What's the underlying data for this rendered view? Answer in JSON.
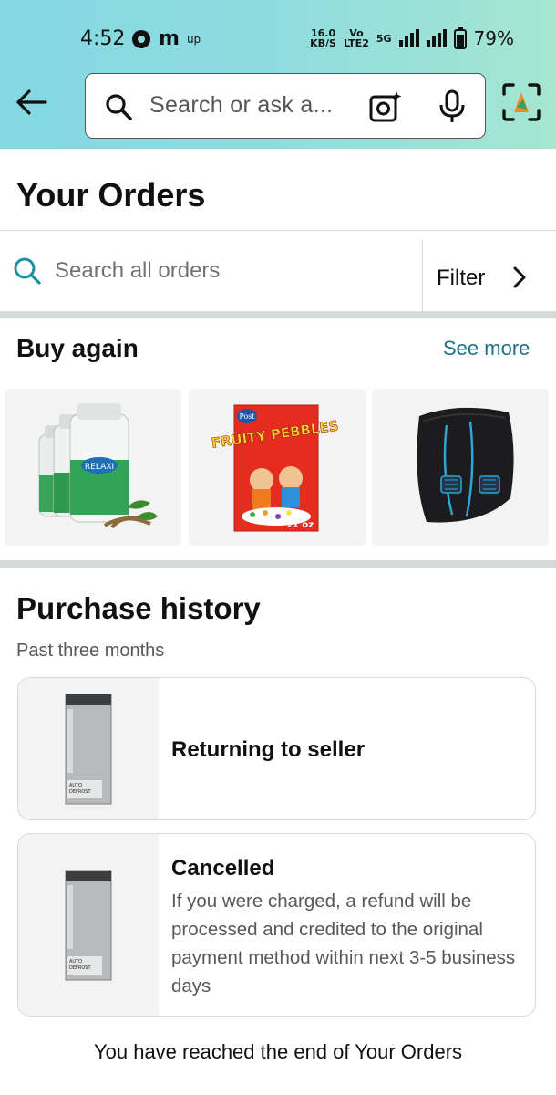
{
  "status_bar": {
    "time": "4:52",
    "app_icons": [
      "m",
      "up"
    ],
    "speed_value": "16.0",
    "speed_unit": "KB/S",
    "network_labels": [
      "Vo",
      "LTE2",
      "5G"
    ],
    "battery": "79%"
  },
  "header": {
    "search_placeholder": "Search or ask a...",
    "icons": [
      "back-arrow-icon",
      "search-icon",
      "camera-icon",
      "microphone-icon",
      "scan-icon"
    ],
    "accent_color": "#8fdce0"
  },
  "page": {
    "title": "Your Orders"
  },
  "order_search": {
    "placeholder": "Search all orders",
    "filter_label": "Filter"
  },
  "buy_again": {
    "title": "Buy again",
    "see_more": "See more",
    "items": [
      {
        "name": "Relaxi capsules bottles",
        "label_text": "RELAXI"
      },
      {
        "name": "Post Fruity Pebbles cereal",
        "label_text": "FRUITY PEBBLES",
        "brand": "Post",
        "size": "11 oz"
      },
      {
        "name": "Lumbar support back cushion"
      }
    ]
  },
  "purchase_history": {
    "title": "Purchase history",
    "subtitle": "Past three months",
    "orders": [
      {
        "status": "Returning to seller",
        "detail": "",
        "image": "refrigerator",
        "image_text": [
          "AUTO",
          "DEFROST"
        ]
      },
      {
        "status": "Cancelled",
        "detail": "If you were charged, a refund will be processed and credited to the original payment method within next 3-5 business days",
        "image": "refrigerator",
        "image_text": [
          "AUTO",
          "DEFROST"
        ]
      }
    ]
  },
  "footer": {
    "end_message": "You have reached the end of Your Orders"
  },
  "colors": {
    "link": "#1f6f8b",
    "search_icon_teal": "#1d8ea1",
    "divider_band": "#d5dbdb"
  }
}
